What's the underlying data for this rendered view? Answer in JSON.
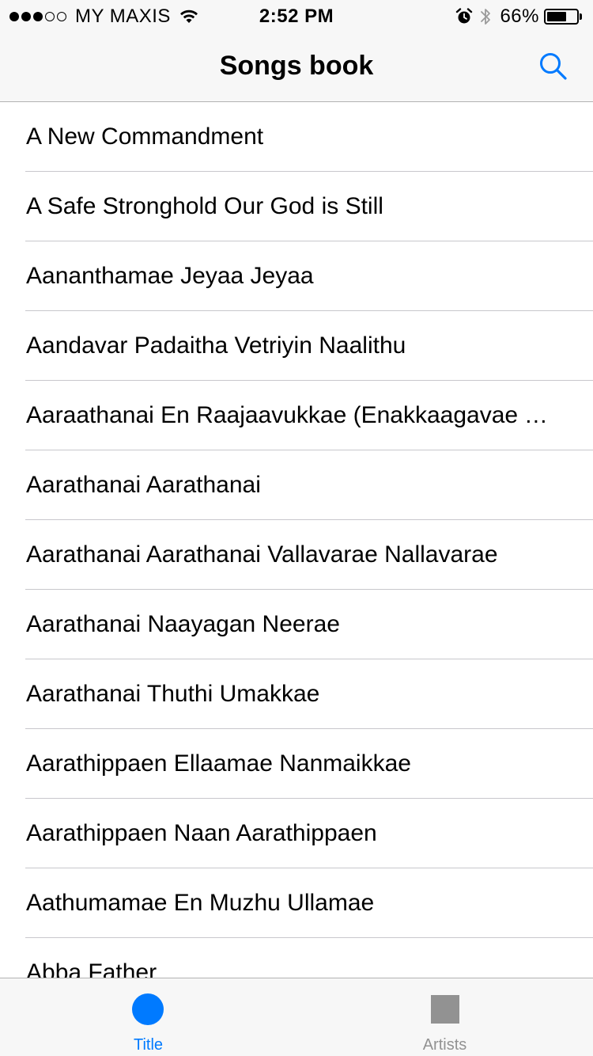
{
  "status_bar": {
    "carrier": "MY MAXIS",
    "signal_filled": 3,
    "signal_total": 5,
    "time": "2:52 PM",
    "battery_percent_label": "66%",
    "battery_level": 0.66,
    "icons": [
      "signal-dots-icon",
      "wifi-icon",
      "alarm-icon",
      "bluetooth-icon",
      "battery-icon"
    ]
  },
  "nav": {
    "title": "Songs book",
    "search_icon": "search-icon"
  },
  "songs": [
    "A New Commandment",
    "A Safe Stronghold Our God is Still",
    "Aananthamae Jeyaa Jeyaa",
    "Aandavar Padaitha Vetriyin Naalithu",
    "Aaraathanai En Raajaavukkae (Enakkaagavae Ya…",
    "Aarathanai Aarathanai",
    "Aarathanai Aarathanai Vallavarae Nallavarae",
    "Aarathanai Naayagan Neerae",
    "Aarathanai Thuthi Umakkae",
    "Aarathippaen Ellaamae Nanmaikkae",
    "Aarathippaen Naan Aarathippaen",
    "Aathumamae En Muzhu Ullamae",
    "Abba Father"
  ],
  "tabs": [
    {
      "label": "Title",
      "icon": "circle-icon",
      "selected": true
    },
    {
      "label": "Artists",
      "icon": "square-icon",
      "selected": false
    }
  ],
  "colors": {
    "accent": "#007aff",
    "tab_active": "#007aff",
    "tab_inactive": "#929292",
    "separator": "#c8c7cc",
    "bar_background": "#f7f7f7"
  }
}
